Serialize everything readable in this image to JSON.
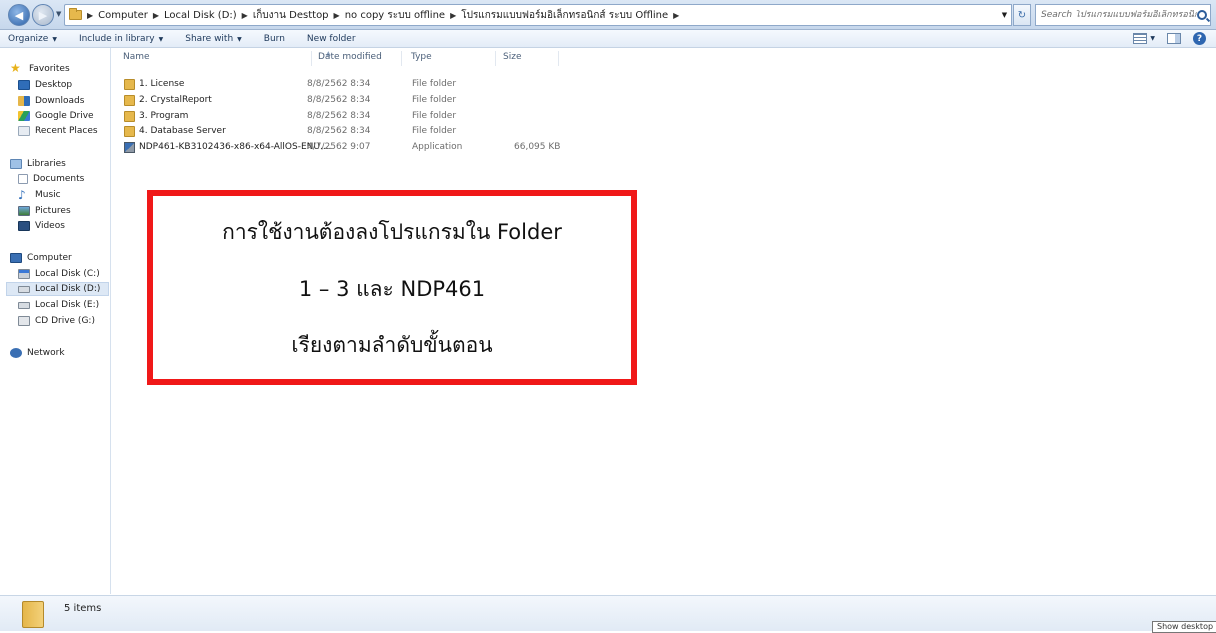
{
  "nav": {
    "breadcrumb": [
      "Computer",
      "Local Disk (D:)",
      "เก็บงาน Desttop",
      "no copy ระบบ offline",
      "โปรแกรมแบบฟอร์มอิเล็กทรอนิกส์ ระบบ Offline"
    ],
    "search_placeholder": "Search โปรแกรมแบบฟอร์มอิเล็กทรอนิกส์ ..."
  },
  "toolbar": {
    "organize": "Organize",
    "include_in_library": "Include in library",
    "share_with": "Share with",
    "burn": "Burn",
    "new_folder": "New folder"
  },
  "sidebar": {
    "favorites": "Favorites",
    "desktop": "Desktop",
    "downloads": "Downloads",
    "google_drive": "Google Drive",
    "recent_places": "Recent Places",
    "libraries": "Libraries",
    "documents": "Documents",
    "music": "Music",
    "pictures": "Pictures",
    "videos": "Videos",
    "computer": "Computer",
    "local_c": "Local Disk (C:)",
    "local_d": "Local Disk (D:)",
    "local_e": "Local Disk (E:)",
    "cd_drive": "CD Drive (G:)",
    "network": "Network"
  },
  "columns": {
    "name": "Name",
    "date_modified": "Date modified",
    "type": "Type",
    "size": "Size"
  },
  "files": [
    {
      "name": "1. License",
      "date": "8/8/2562 8:34",
      "type": "File folder",
      "size": "",
      "icon": "folder-icon"
    },
    {
      "name": "2. CrystalReport",
      "date": "8/8/2562 8:34",
      "type": "File folder",
      "size": "",
      "icon": "folder-icon"
    },
    {
      "name": "3. Program",
      "date": "8/8/2562 8:34",
      "type": "File folder",
      "size": "",
      "icon": "folder-icon"
    },
    {
      "name": "4. Database Server",
      "date": "8/8/2562 8:34",
      "type": "File folder",
      "size": "",
      "icon": "folder-icon"
    },
    {
      "name": "NDP461-KB3102436-x86-x64-AllOS-ENU....",
      "date": "4/7/2562 9:07",
      "type": "Application",
      "size": "66,095 KB",
      "icon": "installer-icon"
    }
  ],
  "callout": {
    "line1": "การใช้งานต้องลงโปรแกรมใน Folder",
    "line2": "1 – 3 และ NDP461",
    "line3": "เรียงตามลำดับขั้นตอน",
    "border_color": "#f01818"
  },
  "status": {
    "item_count": "5 items"
  },
  "tooltip": {
    "show_desktop": "Show desktop"
  }
}
